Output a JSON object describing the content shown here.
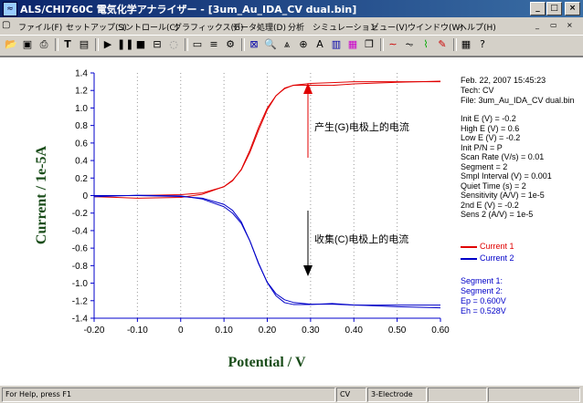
{
  "window": {
    "title": "ALS/CHI760C  電気化学アナライザー - [3um_Au_IDA_CV dual.bin]",
    "controls": [
      "_",
      "□",
      "×"
    ]
  },
  "menu": [
    "ファイル(F)",
    "セットアップ(S)",
    "コントロール(C)",
    "グラフィックス(G)",
    "データ処理(D)",
    "分析",
    "シミュレーション",
    "ビュー(V)",
    "ウインドウ(W)",
    "ヘルプ(H)"
  ],
  "toolbar_icons": [
    "open-icon",
    "save-icon",
    "print-icon",
    "print-preview-icon",
    "technique-icon",
    "parameters-icon",
    "run-icon",
    "pause-icon",
    "stop-icon",
    "reverse-icon",
    "graph-icon",
    "zoom-icon",
    "overlay-icon",
    "add-data-icon",
    "data-list-icon",
    "color-icon",
    "copy-icon",
    "smooth-icon",
    "derivative-icon",
    "integrate-icon",
    "report-icon",
    "help-icon"
  ],
  "info_panel": {
    "date": "Feb. 22, 2007    15:45:23",
    "tech": "Tech: CV",
    "file": "File: 3um_Au_IDA_CV dual.bin",
    "params": [
      "Init E (V) = -0.2",
      "High E (V) = 0.6",
      "Low E (V) = -0.2",
      "Init P/N = P",
      "Scan Rate (V/s) = 0.01",
      "Segment = 2",
      "Smpl Interval (V) = 0.001",
      "Quiet Time (s) = 2",
      "Sensitivity (A/V) = 1e-5",
      "2nd E (V) = -0.2",
      "Sens 2 (A/V) = 1e-5"
    ],
    "legend": [
      {
        "name": "Current 1",
        "color": "#e00000"
      },
      {
        "name": "Current 2",
        "color": "#0000c8"
      }
    ],
    "results": [
      "Segment 1:",
      "Segment 2:",
      "Ep = 0.600V",
      "Eh = 0.528V"
    ]
  },
  "annotations": {
    "generator": "产生(G)电极上的电流",
    "collector": "收集(C)电极上的电流"
  },
  "status": {
    "help": "For Help, press F1",
    "tech": "CV",
    "electrode": "3-Electrode"
  },
  "chart_data": {
    "type": "line",
    "xlabel": "Potential / V",
    "ylabel": "Current / 1e-5A",
    "xlim": [
      -0.2,
      0.6
    ],
    "ylim": [
      -1.4,
      1.4
    ],
    "x_ticks": [
      "-0.20",
      "-0.10",
      "0",
      "0.10",
      "0.20",
      "0.30",
      "0.40",
      "0.50",
      "0.60"
    ],
    "y_ticks": [
      "1.4",
      "1.2",
      "1.0",
      "0.8",
      "0.6",
      "0.4",
      "0.2",
      "0",
      "-0.2",
      "-0.4",
      "-0.6",
      "-0.8",
      "-1.0",
      "-1.2",
      "-1.4"
    ],
    "grid": true,
    "series": [
      {
        "name": "Current 1",
        "color": "#e00000",
        "x": [
          -0.2,
          -0.1,
          0,
          0.05,
          0.1,
          0.12,
          0.14,
          0.16,
          0.18,
          0.2,
          0.22,
          0.24,
          0.26,
          0.3,
          0.35,
          0.4,
          0.5,
          0.6
        ],
        "y": [
          0,
          0,
          0.01,
          0.03,
          0.1,
          0.17,
          0.3,
          0.52,
          0.78,
          1.0,
          1.14,
          1.22,
          1.26,
          1.28,
          1.29,
          1.3,
          1.3,
          1.3
        ]
      },
      {
        "name": "Current 2",
        "color": "#0000c8",
        "x": [
          -0.2,
          -0.1,
          0,
          0.05,
          0.1,
          0.12,
          0.14,
          0.16,
          0.18,
          0.2,
          0.22,
          0.24,
          0.26,
          0.3,
          0.35,
          0.4,
          0.5,
          0.6
        ],
        "y": [
          0,
          0,
          -0.01,
          -0.03,
          -0.1,
          -0.17,
          -0.3,
          -0.52,
          -0.78,
          -0.99,
          -1.12,
          -1.19,
          -1.22,
          -1.24,
          -1.24,
          -1.25,
          -1.25,
          -1.25
        ]
      }
    ]
  }
}
